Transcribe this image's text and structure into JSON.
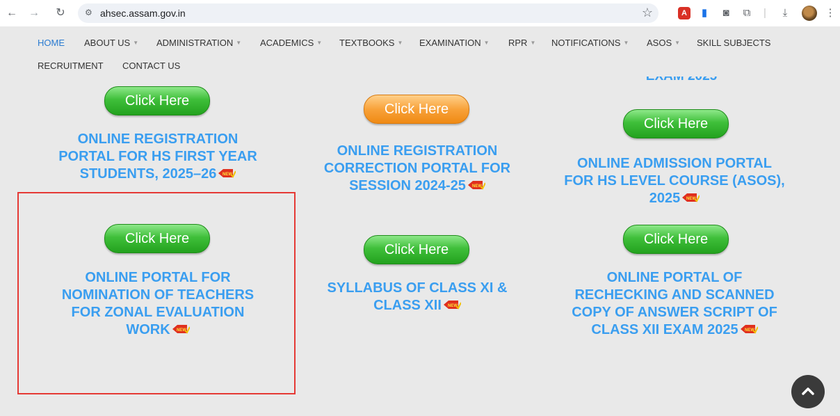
{
  "browser": {
    "url": "ahsec.assam.gov.in",
    "icons": [
      "back-icon",
      "forward-icon",
      "reload-icon",
      "site-settings-icon",
      "bookmark-star-icon",
      "pdf-extension-icon",
      "doc-extension-icon",
      "camera-extension-icon",
      "extensions-icon",
      "download-icon",
      "profile-avatar",
      "menu-icon"
    ]
  },
  "nav": {
    "items": [
      {
        "label": "HOME",
        "caret": false
      },
      {
        "label": "ABOUT US",
        "caret": true
      },
      {
        "label": "ADMINISTRATION",
        "caret": true
      },
      {
        "label": "ACADEMICS",
        "caret": true
      },
      {
        "label": "TEXTBOOKS",
        "caret": true
      },
      {
        "label": "EXAMINATION",
        "caret": true
      },
      {
        "label": "RPR",
        "caret": true
      },
      {
        "label": "NOTIFICATIONS",
        "caret": true
      },
      {
        "label": "ASOS",
        "caret": true
      },
      {
        "label": "SKILL SUBJECTS",
        "caret": false
      },
      {
        "label": "RECRUITMENT",
        "caret": false
      },
      {
        "label": "CONTACT US",
        "caret": false
      }
    ],
    "caret_symbol": "▼"
  },
  "content": {
    "partial_title": "EXAM 2025",
    "button_label": "Click Here",
    "cards": [
      {
        "title_lines": [
          "ONLINE REGISTRATION",
          "PORTAL FOR HS FIRST YEAR",
          "STUDENTS, 2025–26"
        ]
      },
      {
        "title_lines": [
          "ONLINE REGISTRATION",
          "CORRECTION PORTAL FOR",
          "SESSION 2024-25"
        ]
      },
      {
        "title_lines": [
          "ONLINE ADMISSION PORTAL",
          "FOR HS LEVEL COURSE (ASOS),",
          "2025"
        ]
      },
      {
        "title_lines": [
          "ONLINE PORTAL FOR",
          "NOMINATION OF TEACHERS",
          "FOR ZONAL EVALUATION",
          "WORK"
        ]
      },
      {
        "title_lines": [
          "SYLLABUS OF CLASS XI &",
          "CLASS XII"
        ]
      },
      {
        "title_lines": [
          "ONLINE PORTAL OF",
          "RECHECKING AND SCANNED",
          "COPY OF ANSWER SCRIPT OF",
          "CLASS XII EXAM 2025"
        ]
      }
    ],
    "new_badge_text": "NEW",
    "colors": {
      "title_blue": "#3a9ef0",
      "nav_active": "#2a7bd1",
      "highlight_red": "#e53935",
      "button_green": "#3fbf3a",
      "button_orange": "#f8a23a"
    }
  }
}
